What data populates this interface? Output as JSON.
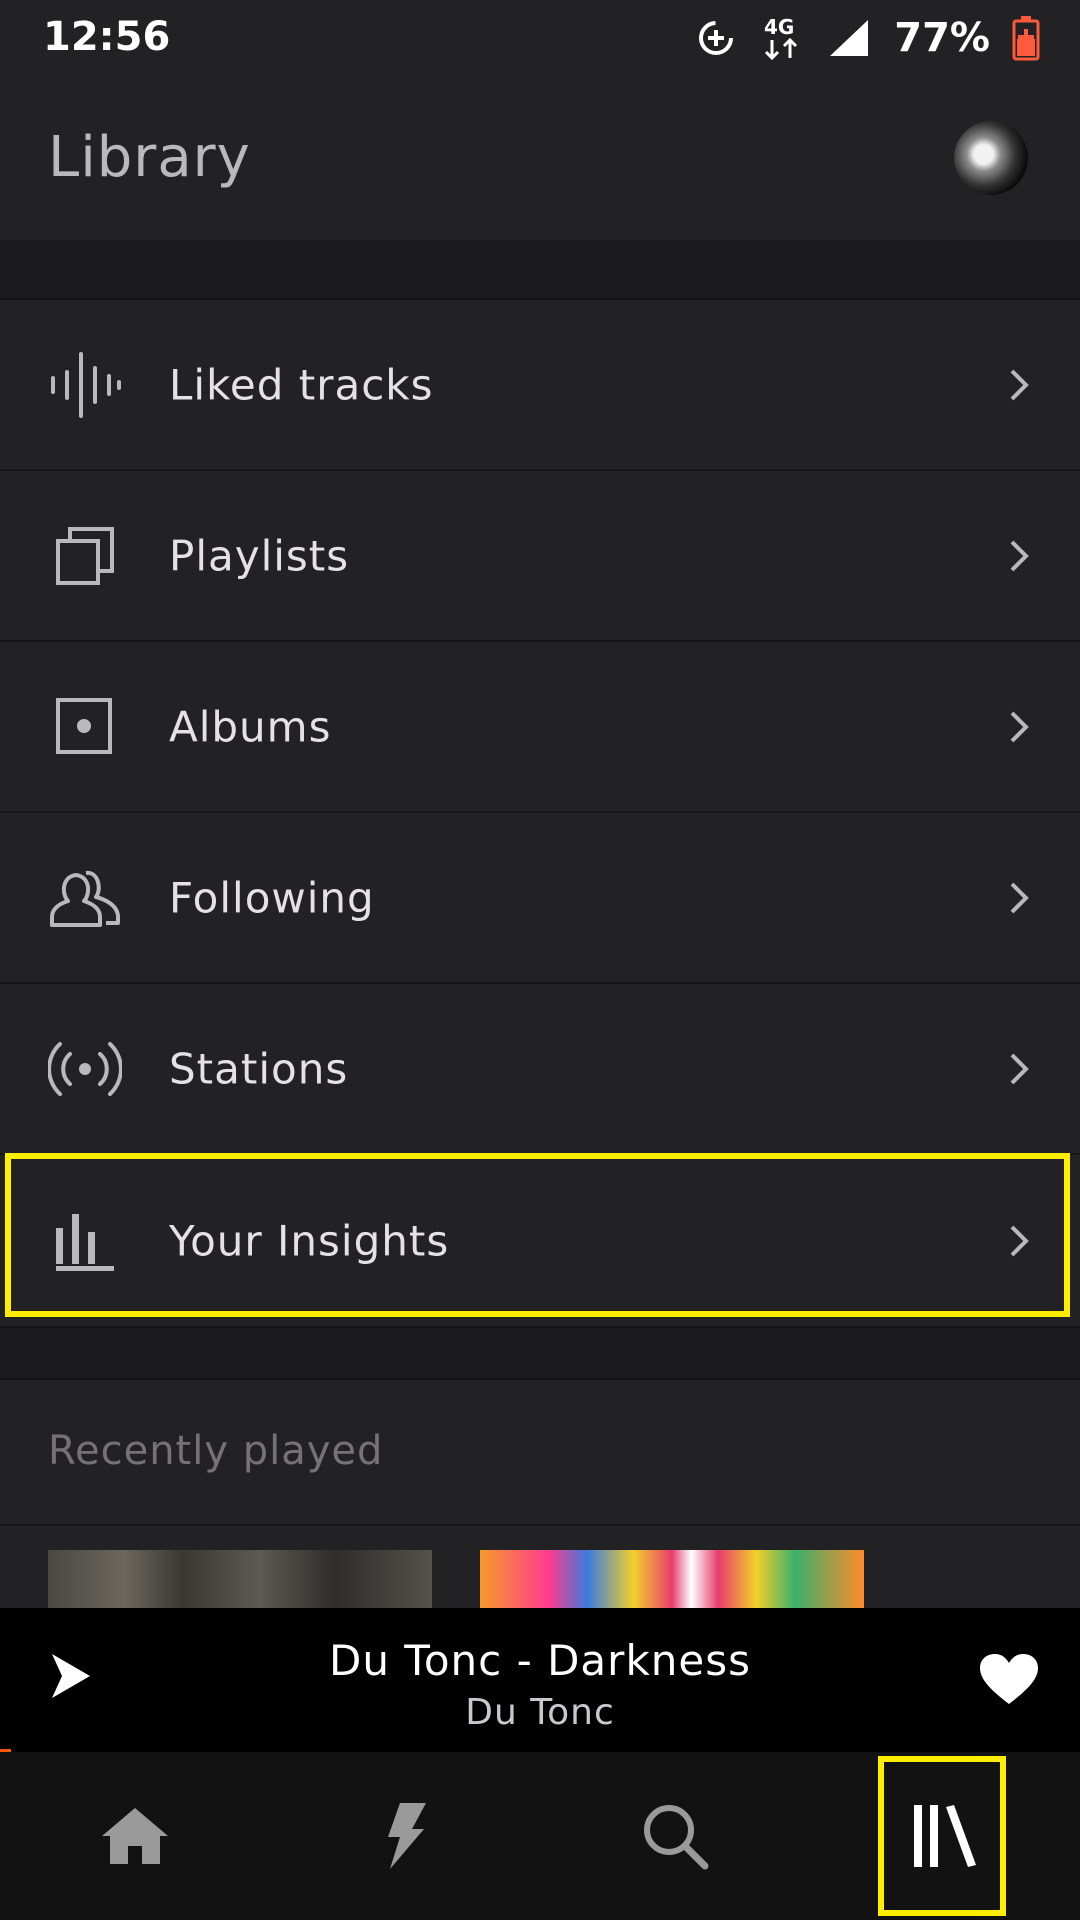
{
  "status_bar": {
    "time": "12:56",
    "battery_percent": "77%",
    "network": "4G",
    "icons": [
      "data-saver-icon",
      "network-4g-icon",
      "signal-icon",
      "battery-charging-icon"
    ]
  },
  "header": {
    "title": "Library",
    "avatar": "profile-avatar"
  },
  "menu": {
    "items": [
      {
        "label": "Liked tracks",
        "icon": "waveform-icon"
      },
      {
        "label": "Playlists",
        "icon": "stacked-squares-icon"
      },
      {
        "label": "Albums",
        "icon": "album-icon"
      },
      {
        "label": "Following",
        "icon": "people-icon"
      },
      {
        "label": "Stations",
        "icon": "broadcast-icon"
      },
      {
        "label": "Your Insights",
        "icon": "bar-chart-icon"
      }
    ]
  },
  "recent": {
    "title": "Recently played"
  },
  "player": {
    "track_title": "Du Tonc - Darkness",
    "artist": "Du Tonc",
    "progress_fraction": 0.01
  },
  "nav": {
    "items": [
      "home-icon",
      "stream-lightning-icon",
      "search-icon",
      "library-icon"
    ]
  },
  "colors": {
    "background": "#222124",
    "accent": "#ff5500",
    "highlight": "#ffee00"
  }
}
